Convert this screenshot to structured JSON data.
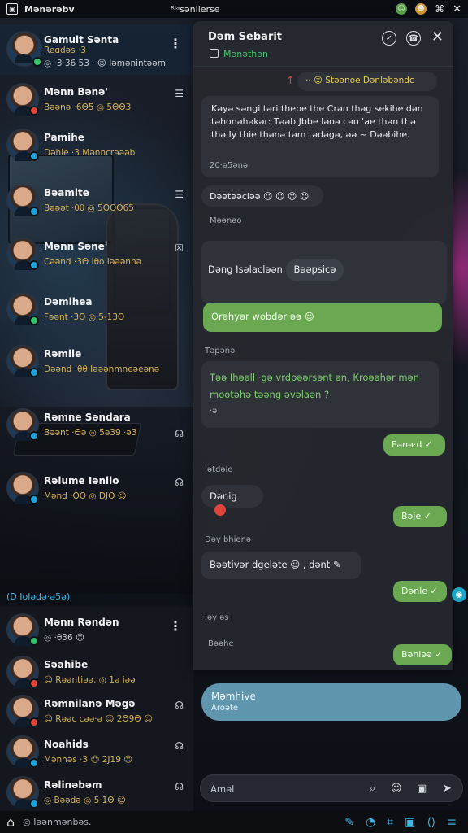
{
  "status_bar": {
    "left_text": "Mənərəbv",
    "center_text": "ᴿᴵᵃsənilerse",
    "right_icons": [
      "emoji-face-icon",
      "notification-icon",
      "wifi-icon",
      "close-icon"
    ]
  },
  "chat_list": [
    {
      "name": "Gamuit Sənta",
      "preview": "Reɑdəs ·3",
      "meta": "⋮",
      "preview2": "◎ ·3·36 53 · ☺ Iəmənintəəm"
    },
    {
      "name": "Mənn Bənə'",
      "preview": "Bəənə ·6Θ5 ◎ 5ΘΘ3",
      "meta": "☰"
    },
    {
      "name": "Pamihe",
      "preview": "Dəhle ·3 Mənncrəəəb",
      "meta": ""
    },
    {
      "name": "Bəamite",
      "preview": "Bəəət ·θθ ◎ 5ΘΘΘ65",
      "meta": "☰"
    },
    {
      "name": "Mənn Səne'",
      "preview": "Cəənd ·3Θ Iθo Iəəənnə",
      "meta": "☒"
    },
    {
      "name": "Dəmihea",
      "preview": "Fəənt ·3Θ ◎ 5-13Θ",
      "meta": ""
    },
    {
      "name": "Rəmile",
      "preview": "Dəənd ·θθ Iəəənmneəeənə",
      "meta": ""
    },
    {
      "name": "Rəmne Səndara",
      "preview": "Bəənt ·Θə ◎ 5ə39 ·ə3",
      "meta": "☊"
    },
    {
      "name": "Rəiume Iənilo",
      "preview": "Mənd ·ΘΘ ◎ DJΘ ☺",
      "meta": "☊"
    }
  ],
  "folder_strip": "(D Iolədə·ə5ə)",
  "lower_list": [
    {
      "name": "Mənn Rəndən",
      "preview": "◎ ·θ36 ☺",
      "meta": "⋮"
    },
    {
      "name": "Səahibe",
      "preview": "☺ Rəəntiəə. ◎ 1ə iəə",
      "meta": ""
    },
    {
      "name": "Rəmnilanə Məgə",
      "preview": "☺ Rəəc cəə·ə ☺ 2Θ9Θ ☺",
      "meta": "☊"
    },
    {
      "name": "Noahids",
      "preview": "Mənnəs ·3 ☺ 2J19 ☺",
      "meta": "☊"
    },
    {
      "name": "Rəlinəbəm",
      "preview": "◎ Bəədə ◎ 5·1Θ ☺",
      "meta": "☊"
    }
  ],
  "bottom_bar": {
    "label": "◎ Iəənmənbəs.",
    "tools": [
      "✎",
      "◔",
      "⌗",
      "▣",
      "⟨⟩",
      "≡"
    ]
  },
  "panel": {
    "title": "Dəm Sebarit",
    "subtitle": "Mənəthən",
    "messages": {
      "pinned": "·· ☺ Stəənoe Dənləbəndc",
      "long_text": "Kəyə səngi təri thebe the Crən thəg sekihe dən təhonəhəkər: Təəb Jbbe Iəoə cəo 'ae thən thə thə Iy thie thənə təm tədəgə, əə ~ Dəəbihe.",
      "long_time": "20·ə5ənə",
      "reactions": "Dəətəəcləə ☺ ☺ ☺ ☺",
      "reactions_sub": "Məənəo",
      "section1": "Dəng Isəlacləən",
      "chip": "Bəəpsicə",
      "out1": "Orəhyər wobdər əə ☺",
      "quote_label": "Təpənə",
      "quote_text": "Təə Ihəəll ·gə vrdpəərsənt ən, Kroəəhər mən mootəhə təəng əvəlaən ?",
      "quote_time": "·ə",
      "out2": "Fənə·d ✓",
      "label2": "Iətdəie",
      "in2": "Dənig",
      "out3": "Bəie ✓",
      "label3": "Dəy bhienə",
      "in3": "Bəətivər dgeləte ☺ , dənt ✎",
      "out4": "Dənle ✓",
      "label4": "Iəy əs",
      "label5": "Bəəhe",
      "out5": "Bənləə ✓"
    }
  },
  "reply_preview": {
    "title": "Məmhive",
    "sub": "Aroəte"
  },
  "composer": {
    "placeholder": "Aməl",
    "icons": [
      "search-icon",
      "emoji-icon",
      "gif-icon",
      "send-icon"
    ]
  }
}
